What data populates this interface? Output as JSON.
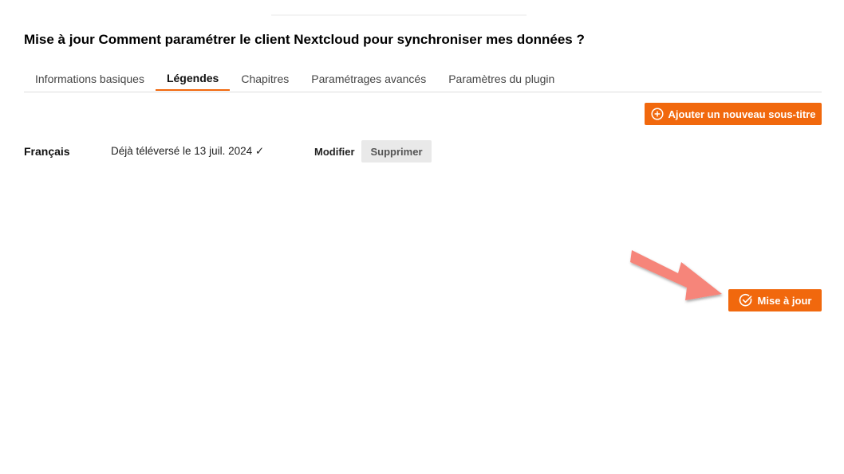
{
  "title": "Mise à jour Comment paramétrer le client Nextcloud pour synchroniser mes données ?",
  "tabs": [
    {
      "label": "Informations basiques",
      "active": false
    },
    {
      "label": "Légendes",
      "active": true
    },
    {
      "label": "Chapitres",
      "active": false
    },
    {
      "label": "Paramétrages avancés",
      "active": false
    },
    {
      "label": "Paramètres du plugin",
      "active": false
    }
  ],
  "add_caption_button": {
    "label": "Ajouter un nouveau sous-titre",
    "icon": "plus-circle-icon"
  },
  "caption": {
    "language": "Français",
    "status": "Déjà téléversé le 13 juil. 2024 ✓",
    "modify_label": "Modifier",
    "delete_label": "Supprimer"
  },
  "update_button": {
    "label": "Mise à jour",
    "icon": "check-circle-icon"
  },
  "colors": {
    "accent": "#f1680d",
    "arrow": "#f6857a"
  }
}
